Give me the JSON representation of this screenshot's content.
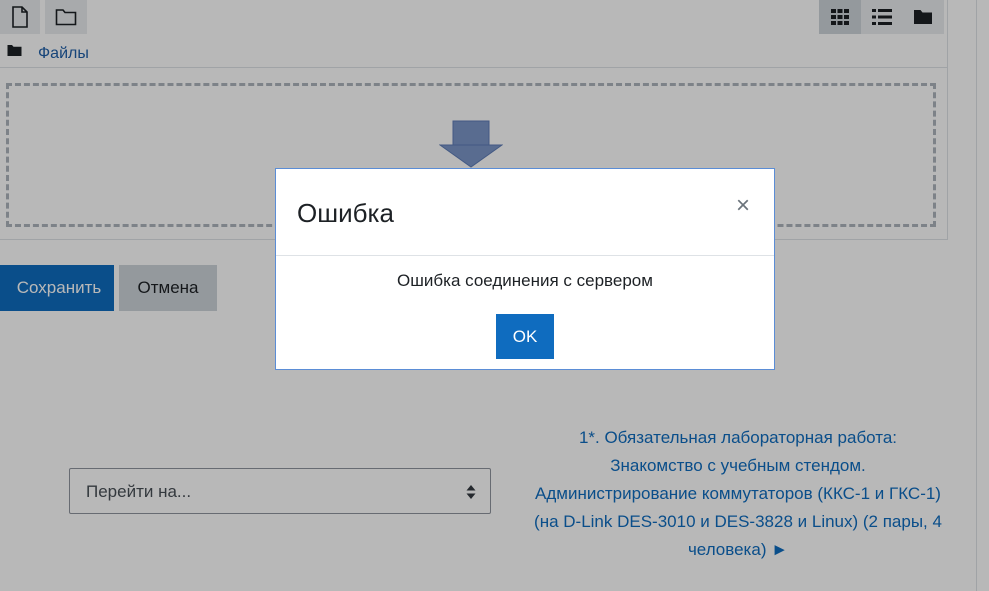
{
  "filemanager": {
    "path_label": "Файлы"
  },
  "form": {
    "save_label": "Сохранить",
    "cancel_label": "Отмена"
  },
  "navigation": {
    "jump_placeholder": "Перейти на...",
    "next_activity_label": "1*. Обязательная лабораторная работа: Знакомство с учебным стендом. Администрирование коммутаторов (ККС-1 и ГКС-1) (на D-Link DES-3010 и DES-3828 и Linux) (2 пары, 4 человека) ►"
  },
  "modal": {
    "title": "Ошибка",
    "close_symbol": "×",
    "message": "Ошибка соединения с сервером",
    "ok_label": "OK"
  },
  "colors": {
    "primary": "#0f6cbf",
    "secondary": "#ced4da",
    "backdrop": "rgba(0,0,0,0.28)"
  },
  "icons": {
    "toolbar_left": [
      "file-icon",
      "folder-icon"
    ],
    "toolbar_right": [
      "grid-view-icon",
      "list-view-icon",
      "tree-view-icon"
    ]
  }
}
